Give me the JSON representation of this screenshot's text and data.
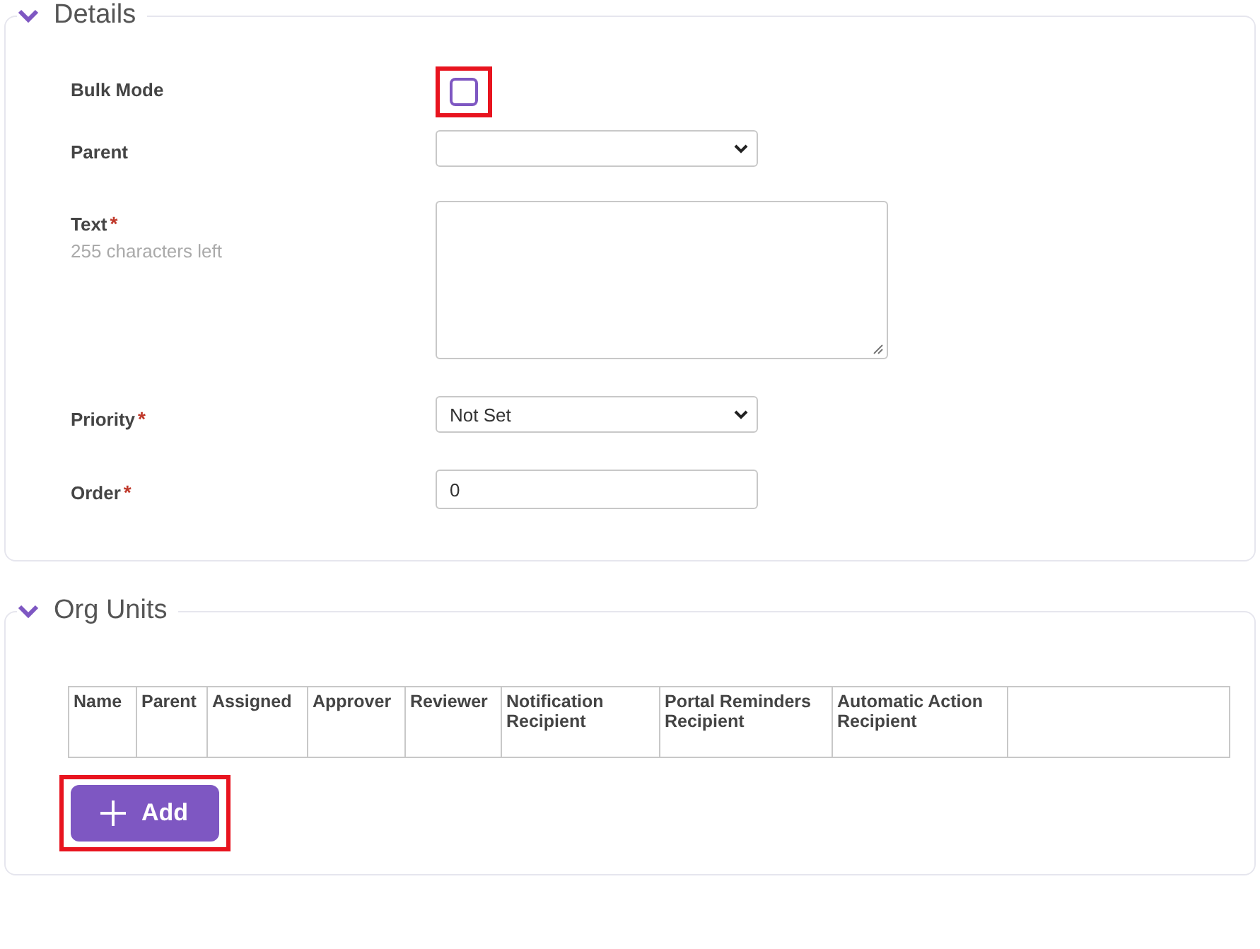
{
  "sections": [
    {
      "title": "Details",
      "expanded": true,
      "kind": "form",
      "fields": [
        {
          "kind": "checkbox",
          "label": "Bulk Mode",
          "checked": false,
          "highlighted": true
        },
        {
          "kind": "select",
          "label": "Parent"
        },
        {
          "kind": "textarea",
          "label": "Text",
          "required_mark": "*",
          "hint": "255 characters left"
        },
        {
          "kind": "select",
          "label": "Priority",
          "required_mark": "*",
          "value": "Not Set"
        },
        {
          "kind": "input",
          "label": "Order",
          "required_mark": "*",
          "value": "0"
        }
      ]
    },
    {
      "title": "Org Units",
      "expanded": true,
      "kind": "table",
      "columns": [
        "Name",
        "Parent",
        "Assigned",
        "Approver",
        "Reviewer",
        "Notification Recipient",
        "Portal Reminders Recipient",
        "Automatic Action Recipient"
      ],
      "add_button": {
        "label": "Add",
        "highlighted": true
      }
    }
  ]
}
